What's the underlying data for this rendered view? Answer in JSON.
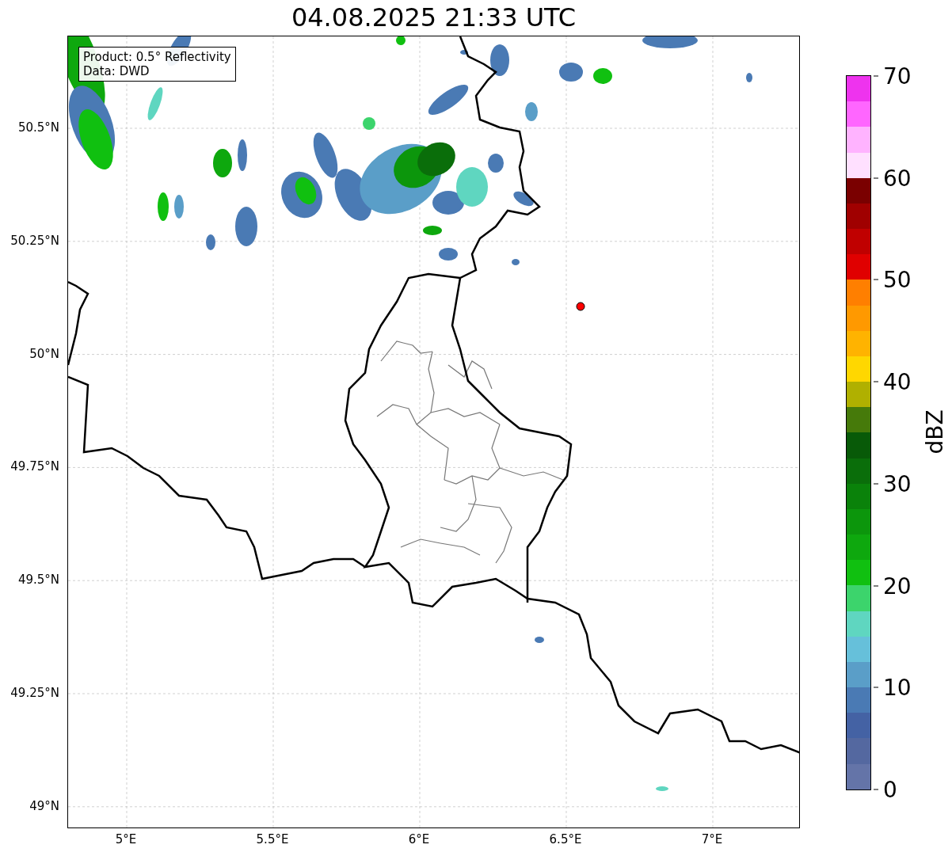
{
  "title": "04.08.2025 21:33 UTC",
  "legend": {
    "lines": [
      "Product: 0.5° Reflectivity",
      "Data: DWD"
    ]
  },
  "lat_ticks": [
    "50.5°N",
    "50.25°N",
    "50°N",
    "49.75°N",
    "49.5°N",
    "49.25°N",
    "49°N"
  ],
  "lon_ticks": [
    "5°E",
    "5.5°E",
    "6°E",
    "6.5°E",
    "7°E"
  ],
  "colorbar": {
    "label": "dBZ",
    "ticks": [
      "70",
      "60",
      "50",
      "40",
      "30",
      "20",
      "10",
      "0"
    ],
    "segments": [
      {
        "color": "#ee33ee"
      },
      {
        "color": "#ff66ff"
      },
      {
        "color": "#ffb3ff"
      },
      {
        "color": "#ffe0ff"
      },
      {
        "color": "#7a0000"
      },
      {
        "color": "#a00000"
      },
      {
        "color": "#c00000"
      },
      {
        "color": "#e00000"
      },
      {
        "color": "#ff7f00"
      },
      {
        "color": "#ff9900"
      },
      {
        "color": "#ffb300"
      },
      {
        "color": "#ffd700"
      },
      {
        "color": "#b0b000"
      },
      {
        "color": "#467a0a"
      },
      {
        "color": "#085a08"
      },
      {
        "color": "#0a6e0a"
      },
      {
        "color": "#0a820a"
      },
      {
        "color": "#0c960c"
      },
      {
        "color": "#0ea80e"
      },
      {
        "color": "#10c010"
      },
      {
        "color": "#3cd46c"
      },
      {
        "color": "#5fd6c0"
      },
      {
        "color": "#66c0da"
      },
      {
        "color": "#5a9ec8"
      },
      {
        "color": "#4a7ab4"
      },
      {
        "color": "#4462a4"
      },
      {
        "color": "#5468a0"
      },
      {
        "color": "#6474a8"
      }
    ]
  }
}
